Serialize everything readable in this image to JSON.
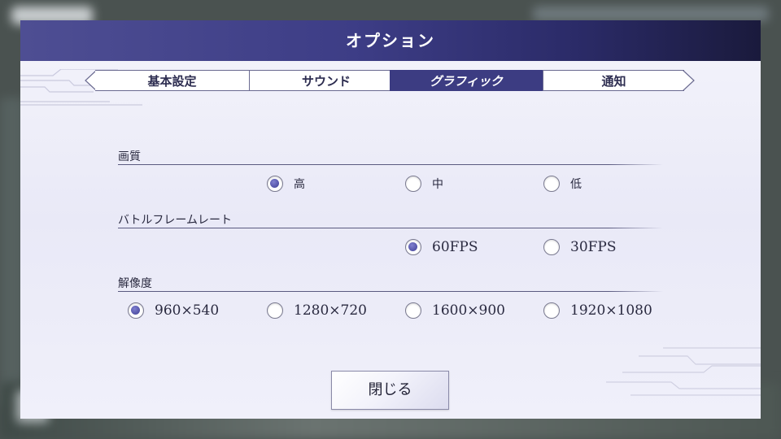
{
  "dialog": {
    "title": "オプション",
    "close_label": "閉じる"
  },
  "tabs": [
    {
      "label": "基本設定",
      "selected": false
    },
    {
      "label": "サウンド",
      "selected": false
    },
    {
      "label": "グラフィック",
      "selected": true
    },
    {
      "label": "通知",
      "selected": false
    }
  ],
  "settings": {
    "quality": {
      "label": "画質",
      "options": [
        "高",
        "中",
        "低"
      ],
      "selected": "高"
    },
    "frame_rate": {
      "label": "バトルフレームレート",
      "options": [
        "60FPS",
        "30FPS"
      ],
      "selected": "60FPS"
    },
    "resolution": {
      "label": "解像度",
      "options": [
        "960×540",
        "1280×720",
        "1600×900",
        "1920×1080"
      ],
      "selected": "960×540"
    }
  },
  "colors": {
    "accent": "#3c3c82",
    "title_bar_start": "#4e4e93",
    "title_bar_end": "#1a1a3c",
    "panel": "#eeeef8"
  }
}
